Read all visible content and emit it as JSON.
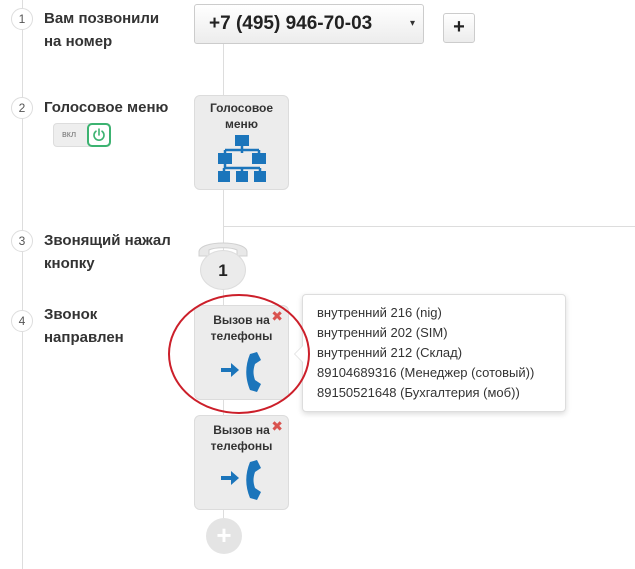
{
  "steps": [
    {
      "number": "1",
      "label_line1": "Вам позвонили",
      "label_line2": "на номер"
    },
    {
      "number": "2",
      "label_line1": "Голосовое меню",
      "label_line2": ""
    },
    {
      "number": "3",
      "label_line1": "Звонящий нажал",
      "label_line2": "кнопку"
    },
    {
      "number": "4",
      "label_line1": "Звонок",
      "label_line2": "направлен"
    }
  ],
  "phone_select": {
    "value": "+7 (495) 946-70-03",
    "caret": "▾"
  },
  "add_button": {
    "label": "+"
  },
  "toggle": {
    "label": "вкл",
    "state": "on"
  },
  "voice_menu_card": {
    "title_line1": "Голосовое",
    "title_line2": "меню",
    "icon": "org-chart-icon"
  },
  "key_pressed": {
    "digit": "1",
    "icon": "telephone-icon"
  },
  "call_cards": [
    {
      "title_line1": "Вызов на",
      "title_line2": "телефоны",
      "delete": "✖",
      "icon": "incoming-call-icon"
    },
    {
      "title_line1": "Вызов на",
      "title_line2": "телефоны",
      "delete": "✖",
      "icon": "incoming-call-icon"
    }
  ],
  "popover_items": [
    "внутренний 216 (nig)",
    "внутренний 202 (SIM)",
    "внутренний 212 (Склад)",
    "89104689316 (Менеджер (сотовый))",
    "89150521648 (Бухгалтерия (моб))"
  ],
  "add_step": {
    "label": "+"
  },
  "colors": {
    "accent_blue": "#1b75bb",
    "toggle_green": "#3cb371",
    "delete_red": "#d9534f",
    "highlight_red": "#cc1f2a"
  }
}
